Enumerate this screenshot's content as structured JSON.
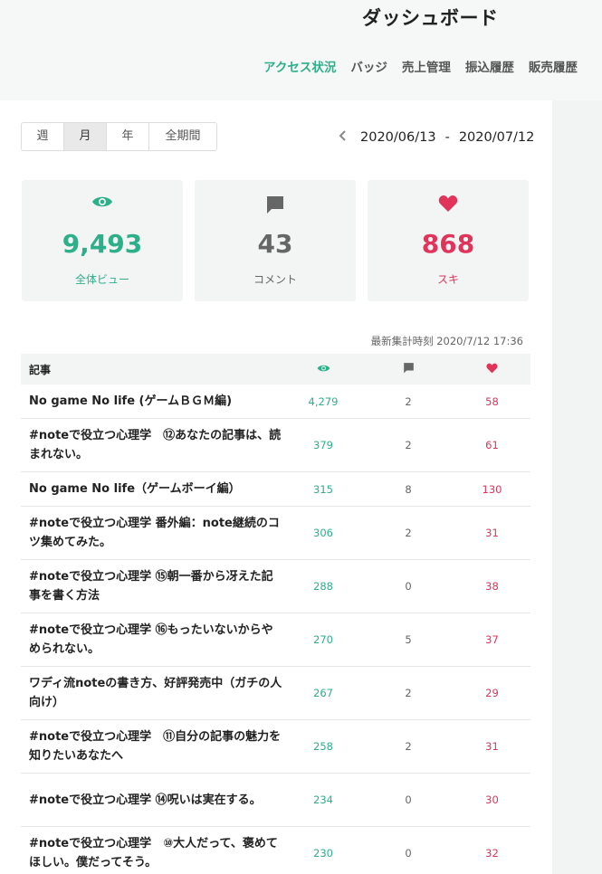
{
  "header": {
    "title": "ダッシュボード",
    "nav": [
      "アクセス状況",
      "バッジ",
      "売上管理",
      "振込履歴",
      "販売履歴"
    ]
  },
  "period": {
    "options": [
      "週",
      "月",
      "年",
      "全期間"
    ],
    "selected": "月",
    "range_start": "2020/06/13",
    "range_sep": "-",
    "range_end": "2020/07/12"
  },
  "stats": {
    "views": {
      "value": "9,493",
      "label": "全体ビュー",
      "color": "#2db08a",
      "icon": "eye-icon"
    },
    "comments": {
      "value": "43",
      "label": "コメント",
      "color": "#666666",
      "icon": "comment-icon"
    },
    "likes": {
      "value": "868",
      "label": "スキ",
      "color": "#e0345b",
      "icon": "heart-icon"
    }
  },
  "updated_text": "最新集計時刻 2020/7/12 17:36",
  "table": {
    "header_title": "記事",
    "rows": [
      {
        "title": "No game No life (ゲームＢＧＭ編)",
        "views": "4,279",
        "comments": "2",
        "likes": "58"
      },
      {
        "title": "#noteで役立つ心理学　⑫あなたの記事は、読まれない。",
        "views": "379",
        "comments": "2",
        "likes": "61"
      },
      {
        "title": "No game No life（ゲームボーイ編）",
        "views": "315",
        "comments": "8",
        "likes": "130"
      },
      {
        "title": "#noteで役立つ心理学 番外編：note継続のコツ集めてみた。",
        "views": "306",
        "comments": "2",
        "likes": "31"
      },
      {
        "title": "#noteで役立つ心理学 ⑮朝一番から冴えた記事を書く方法",
        "views": "288",
        "comments": "0",
        "likes": "38"
      },
      {
        "title": "#noteで役立つ心理学 ⑯もったいないからやめられない。",
        "views": "270",
        "comments": "5",
        "likes": "37"
      },
      {
        "title": "ワディ流noteの書き方、好評発売中（ガチの人向け）",
        "views": "267",
        "comments": "2",
        "likes": "29"
      },
      {
        "title": "#noteで役立つ心理学　⑪自分の記事の魅力を知りたいあなたへ",
        "views": "258",
        "comments": "2",
        "likes": "31"
      },
      {
        "title": "#noteで役立つ心理学 ⑭呪いは実在する。",
        "views": "234",
        "comments": "0",
        "likes": "30"
      },
      {
        "title": "#noteで役立つ心理学　⑩大人だって、褒めてほしい。僕だってそう。",
        "views": "230",
        "comments": "0",
        "likes": "32"
      }
    ]
  }
}
